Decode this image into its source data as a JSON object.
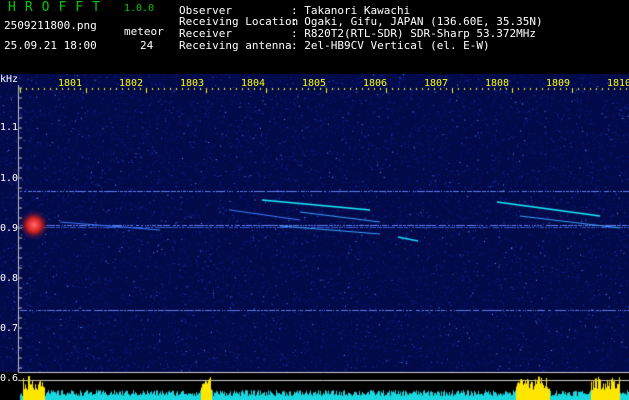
{
  "header": {
    "app_title": "HROFFT",
    "version": "1.0.0",
    "filename": "2509211800.png",
    "meteor_label": "meteor",
    "datetime": "25.09.21 18:00",
    "meteor_count": "24",
    "fields": [
      {
        "label": "Observer",
        "value": ": Takanori Kawachi"
      },
      {
        "label": "Receiving Location",
        "value": ": Ogaki, Gifu, JAPAN (136.60E, 35.35N)"
      },
      {
        "label": "Receiver",
        "value": ": R820T2(RTL-SDR) SDR-Sharp 53.372MHz"
      },
      {
        "label": "Receiving antenna",
        "value": ": 2el-HB9CV Vertical (el. E-W)"
      }
    ]
  },
  "spectrogram": {
    "y_unit": "kHz",
    "y_ticks": [
      "1.1",
      "1.0",
      "0.9",
      "0.8",
      "0.7",
      "0.6"
    ],
    "x_ticks": [
      "1801",
      "1802",
      "1803",
      "1804",
      "1805",
      "1806",
      "1807",
      "1808",
      "1809",
      "1810"
    ],
    "colors": {
      "background": "#030a4a",
      "trace": "#4b7dff",
      "echo": "#19f0ff",
      "hot": "#ff4040",
      "axis_text": "#ffff00"
    }
  }
}
